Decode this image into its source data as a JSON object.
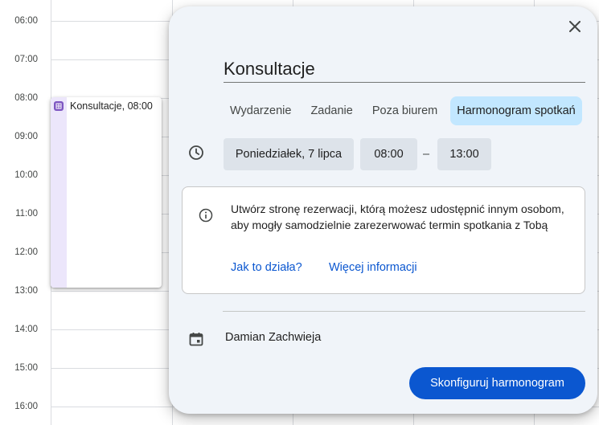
{
  "calendar": {
    "time_labels": [
      "06:00",
      "07:00",
      "08:00",
      "09:00",
      "10:00",
      "11:00",
      "12:00",
      "13:00",
      "14:00",
      "15:00",
      "16:00"
    ],
    "event": {
      "title": "Konsultacje, 08:00",
      "icon": "calendar-grid-icon",
      "color": "#7e57c2"
    }
  },
  "dialog": {
    "close_icon": "close-icon",
    "title_value": "Konsultacje",
    "tabs": [
      {
        "label": "Wydarzenie",
        "active": false
      },
      {
        "label": "Zadanie",
        "active": false
      },
      {
        "label": "Poza biurem",
        "active": false
      },
      {
        "label": "Harmonogram spotkań",
        "active": true
      }
    ],
    "date_label": "Poniedziałek, 7 lipca",
    "start_time": "08:00",
    "separator": "–",
    "end_time": "13:00",
    "info": {
      "text": "Utwórz stronę rezerwacji, którą możesz udostępnić innym osobom, aby mogły samodzielnie zarezerwować termin spotkania z Tobą",
      "link_how": "Jak to działa?",
      "link_more": "Więcej informacji"
    },
    "owner": "Damian Zachwieja",
    "primary_button": "Skonfiguruj harmonogram"
  },
  "colors": {
    "accent": "#0b57d0",
    "tab_active_bg": "#c2e7ff",
    "dialog_bg": "#f0f4f9",
    "chip_bg": "#dde3ea"
  }
}
